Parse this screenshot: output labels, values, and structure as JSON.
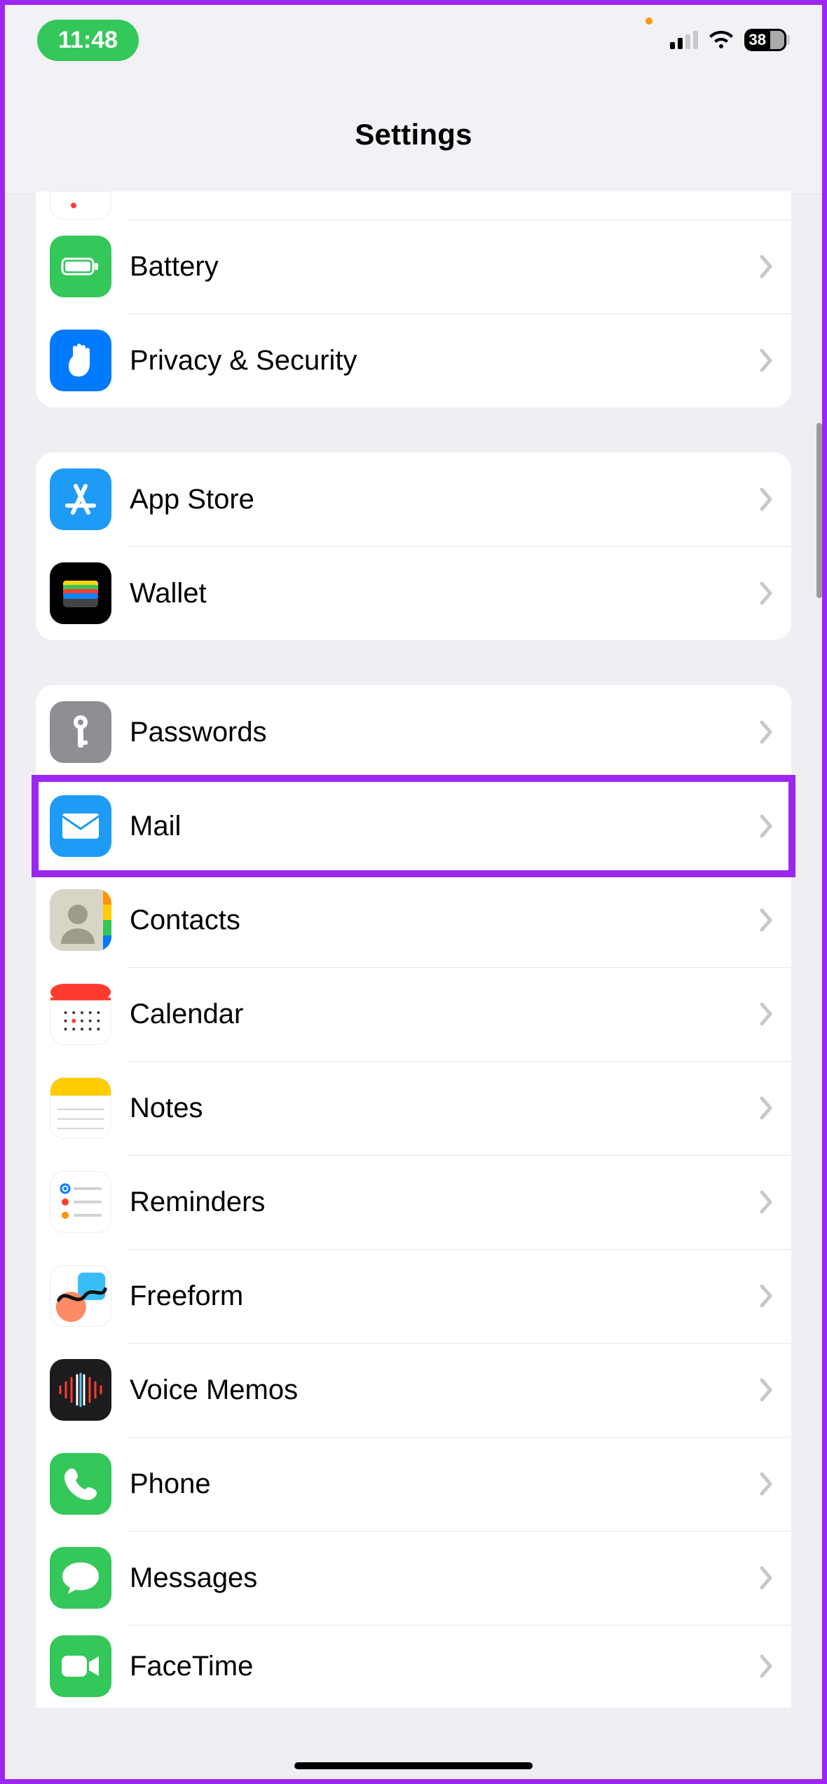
{
  "status_bar": {
    "time": "11:48",
    "battery_percent": "38"
  },
  "nav": {
    "title": "Settings"
  },
  "groups": [
    {
      "id": "system",
      "partial_top": true,
      "rows": [
        {
          "id": "truncated",
          "label": "",
          "icon": "cut-icon"
        },
        {
          "id": "battery",
          "label": "Battery",
          "icon": "battery-icon"
        },
        {
          "id": "privacy",
          "label": "Privacy & Security",
          "icon": "privacy-icon"
        }
      ]
    },
    {
      "id": "store",
      "rows": [
        {
          "id": "appstore",
          "label": "App Store",
          "icon": "appstore-icon"
        },
        {
          "id": "wallet",
          "label": "Wallet",
          "icon": "wallet-icon"
        }
      ]
    },
    {
      "id": "apps",
      "partial_bottom": true,
      "rows": [
        {
          "id": "passwords",
          "label": "Passwords",
          "icon": "passwords-icon"
        },
        {
          "id": "mail",
          "label": "Mail",
          "icon": "mail-icon",
          "highlighted": true
        },
        {
          "id": "contacts",
          "label": "Contacts",
          "icon": "contacts-icon"
        },
        {
          "id": "calendar",
          "label": "Calendar",
          "icon": "calendar-icon"
        },
        {
          "id": "notes",
          "label": "Notes",
          "icon": "notes-icon"
        },
        {
          "id": "reminders",
          "label": "Reminders",
          "icon": "reminders-icon"
        },
        {
          "id": "freeform",
          "label": "Freeform",
          "icon": "freeform-icon"
        },
        {
          "id": "voicememos",
          "label": "Voice Memos",
          "icon": "voicememos-icon"
        },
        {
          "id": "phone",
          "label": "Phone",
          "icon": "phone-icon"
        },
        {
          "id": "messages",
          "label": "Messages",
          "icon": "messages-icon"
        },
        {
          "id": "facetime",
          "label": "FaceTime",
          "icon": "facetime-icon"
        }
      ]
    }
  ]
}
